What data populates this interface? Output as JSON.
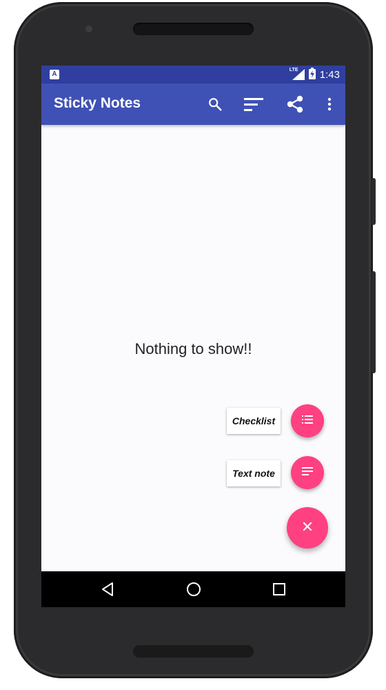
{
  "status_bar": {
    "notification_icon_letter": "A",
    "network_label": "LTE",
    "time": "1:43"
  },
  "app_bar": {
    "title": "Sticky Notes",
    "background": "#3f51b5",
    "status_background": "#303f9f",
    "actions": [
      {
        "name": "search-icon"
      },
      {
        "name": "sort-icon"
      },
      {
        "name": "share-icon"
      },
      {
        "name": "more-vert-icon"
      }
    ]
  },
  "main": {
    "empty_message": "Nothing to show!!"
  },
  "fab_menu": {
    "accent": "#ff4081",
    "items": [
      {
        "label": "Checklist",
        "icon": "checklist-icon"
      },
      {
        "label": "Text note",
        "icon": "text-note-icon"
      }
    ],
    "main_icon": "close-icon"
  },
  "nav_bar": {
    "buttons": [
      "back-icon",
      "home-icon",
      "recents-icon"
    ]
  }
}
